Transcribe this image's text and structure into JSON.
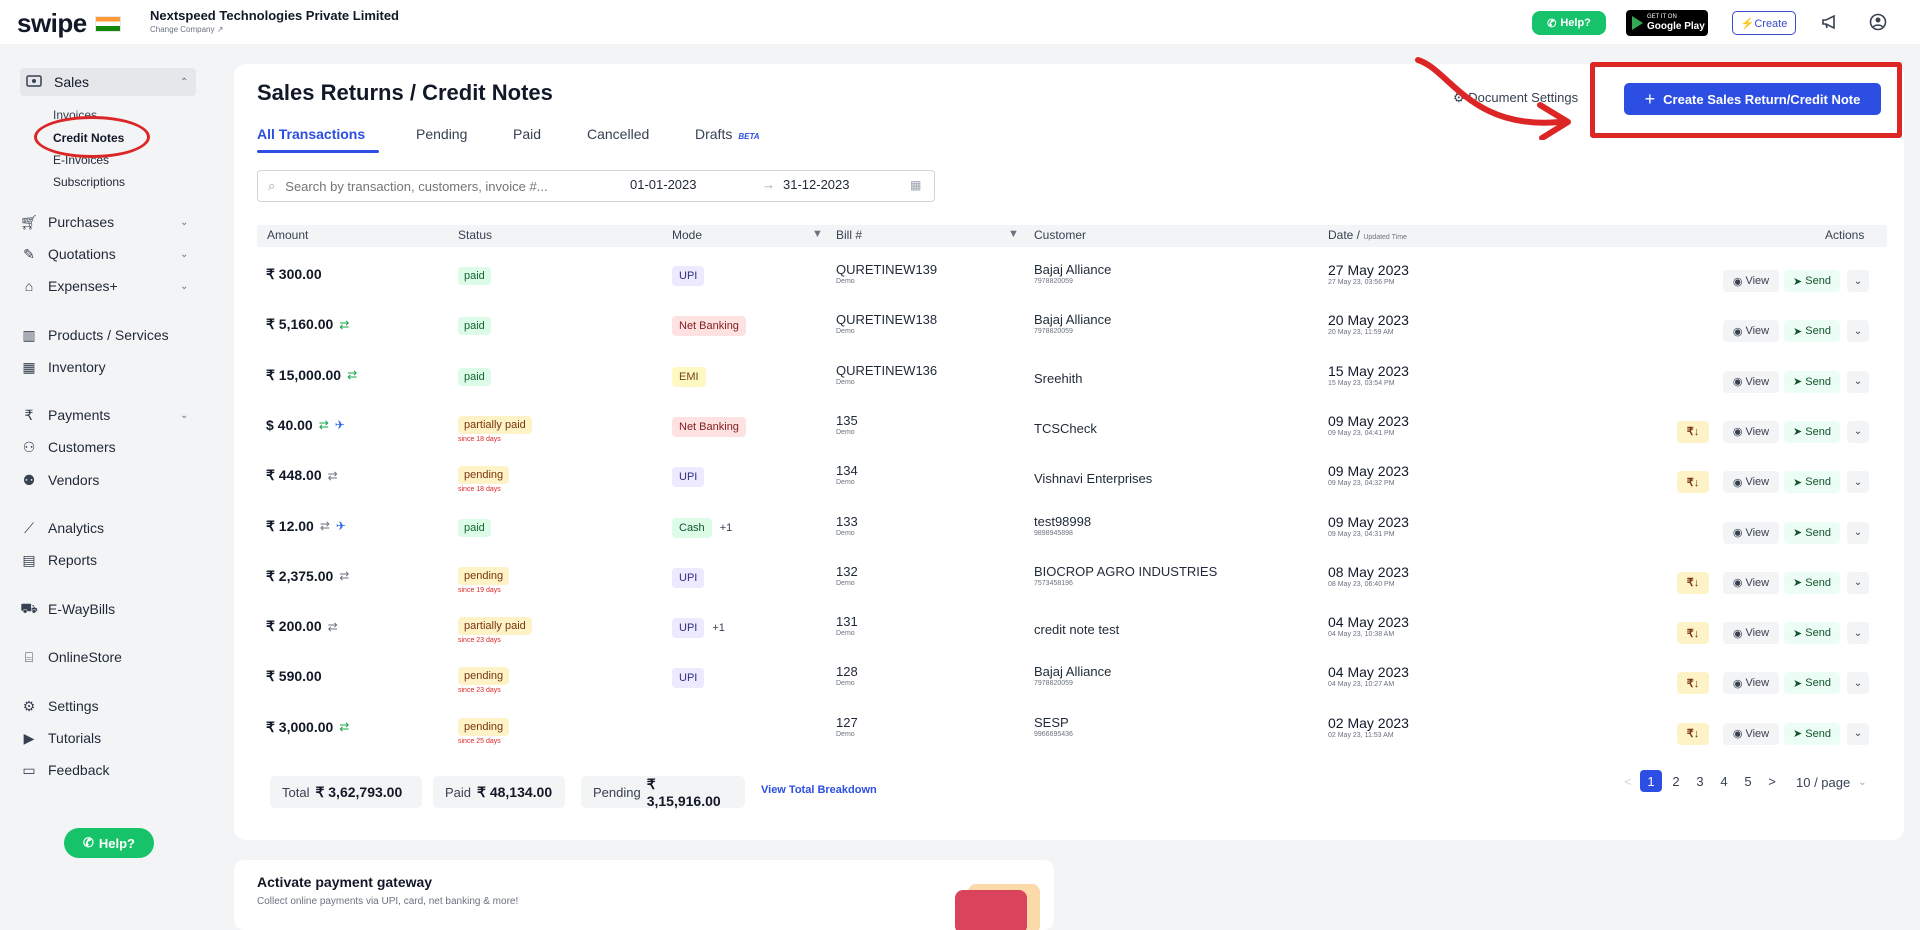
{
  "app": {
    "logo_text": "swipe",
    "company_name": "Nextspeed Technologies Private Limited",
    "change_company": "Change Company ↗"
  },
  "topbar": {
    "help_label": "Help?",
    "gplay_small": "GET IT ON",
    "gplay_big": "Google Play",
    "create_label": "⚡Create"
  },
  "sidebar": {
    "sales": "Sales",
    "sub_items": [
      "Invoices",
      "Credit Notes",
      "E-Invoices",
      "Subscriptions"
    ],
    "items": [
      {
        "label": "Purchases",
        "icon": "cart-icon"
      },
      {
        "label": "Quotations",
        "icon": "pencil-icon"
      },
      {
        "label": "Expenses+",
        "icon": "tag-icon"
      },
      {
        "label": "Products / Services",
        "icon": "barcode-icon"
      },
      {
        "label": "Inventory",
        "icon": "warehouse-icon"
      },
      {
        "label": "Payments",
        "icon": "rupee-icon"
      },
      {
        "label": "Customers",
        "icon": "user-icon"
      },
      {
        "label": "Vendors",
        "icon": "users-icon"
      },
      {
        "label": "Analytics",
        "icon": "chart-icon"
      },
      {
        "label": "Reports",
        "icon": "report-icon"
      },
      {
        "label": "E-WayBills",
        "icon": "truck-icon"
      },
      {
        "label": "OnlineStore",
        "icon": "store-icon"
      },
      {
        "label": "Settings",
        "icon": "gear-icon"
      },
      {
        "label": "Tutorials",
        "icon": "youtube-icon"
      },
      {
        "label": "Feedback",
        "icon": "message-icon"
      }
    ],
    "help_label": "Help?"
  },
  "page": {
    "title": "Sales Returns / Credit Notes",
    "doc_settings": "Document Settings",
    "cta_label": "Create Sales Return/Credit Note",
    "tabs": [
      "All Transactions",
      "Pending",
      "Paid",
      "Cancelled",
      "Drafts"
    ],
    "beta": "BETA",
    "search_placeholder": "Search by transaction, customers, invoice #...",
    "date_from": "01-01-2023",
    "date_sep": "→",
    "date_to": "31-12-2023"
  },
  "table": {
    "headers": {
      "amount": "Amount",
      "status": "Status",
      "mode": "Mode",
      "bill": "Bill #",
      "customer": "Customer",
      "date": "Date / ",
      "date_small": "Updated Time",
      "actions": "Actions"
    },
    "rows": [
      {
        "amount": "₹ 300.00",
        "status": "paid",
        "since": "",
        "mode": "UPI",
        "extra": "",
        "bill": "QURETINEW139",
        "bill_sub": "Demo",
        "customer": "Bajaj Alliance",
        "customer_sub": "7978820059",
        "date": "27 May 2023",
        "date_sub": "27 May 23, 03:56 PM"
      },
      {
        "amount": "₹ 5,160.00",
        "status": "paid",
        "since": "",
        "mode": "Net Banking",
        "extra": "",
        "bill": "QURETINEW138",
        "bill_sub": "Demo",
        "customer": "Bajaj Alliance",
        "customer_sub": "7978820059",
        "date": "20 May 2023",
        "date_sub": "20 May 23, 11:59 AM"
      },
      {
        "amount": "₹ 15,000.00",
        "status": "paid",
        "since": "",
        "mode": "EMI",
        "extra": "",
        "bill": "QURETINEW136",
        "bill_sub": "Demo",
        "customer": "Sreehith",
        "customer_sub": "",
        "date": "15 May 2023",
        "date_sub": "15 May 23, 03:54 PM"
      },
      {
        "amount": "$ 40.00",
        "status": "partially paid",
        "since": "since 18 days",
        "mode": "Net Banking",
        "extra": "",
        "bill": "135",
        "bill_sub": "Demo",
        "customer": "TCSCheck",
        "customer_sub": "",
        "date": "09 May 2023",
        "date_sub": "09 May 23, 04:41 PM"
      },
      {
        "amount": "₹ 448.00",
        "status": "pending",
        "since": "since 18 days",
        "mode": "UPI",
        "extra": "",
        "bill": "134",
        "bill_sub": "Demo",
        "customer": "Vishnavi Enterprises",
        "customer_sub": "",
        "date": "09 May 2023",
        "date_sub": "09 May 23, 04:32 PM"
      },
      {
        "amount": "₹ 12.00",
        "status": "paid",
        "since": "",
        "mode": "Cash",
        "extra": "+1",
        "bill": "133",
        "bill_sub": "Demo",
        "customer": "test98998",
        "customer_sub": "9898945898",
        "date": "09 May 2023",
        "date_sub": "09 May 23, 04:31 PM"
      },
      {
        "amount": "₹ 2,375.00",
        "status": "pending",
        "since": "since 19 days",
        "mode": "UPI",
        "extra": "",
        "bill": "132",
        "bill_sub": "Demo",
        "customer": "BIOCROP AGRO INDUSTRIES",
        "customer_sub": "7573458196",
        "date": "08 May 2023",
        "date_sub": "08 May 23, 06:40 PM"
      },
      {
        "amount": "₹ 200.00",
        "status": "partially paid",
        "since": "since 23 days",
        "mode": "UPI",
        "extra": "+1",
        "bill": "131",
        "bill_sub": "Demo",
        "customer": "credit note test",
        "customer_sub": "",
        "date": "04 May 2023",
        "date_sub": "04 May 23, 10:38 AM"
      },
      {
        "amount": "₹ 590.00",
        "status": "pending",
        "since": "since 23 days",
        "mode": "UPI",
        "extra": "",
        "bill": "128",
        "bill_sub": "Demo",
        "customer": "Bajaj Alliance",
        "customer_sub": "7978820059",
        "date": "04 May 2023",
        "date_sub": "04 May 23, 10:27 AM"
      },
      {
        "amount": "₹ 3,000.00",
        "status": "pending",
        "since": "since 25 days",
        "mode": "",
        "extra": "",
        "bill": "127",
        "bill_sub": "Demo",
        "customer": "SESP",
        "customer_sub": "9966695436",
        "date": "02 May 2023",
        "date_sub": "02 May 23, 11:53 AM"
      }
    ],
    "view_label": "View",
    "send_label": "Send",
    "rupee_label": "₹↓"
  },
  "totals": {
    "total_label": "Total",
    "total_value": "₹ 3,62,793.00",
    "paid_label": "Paid",
    "paid_value": "₹ 48,134.00",
    "pending_label": "Pending",
    "pending_value": "₹ 3,15,916.00",
    "breakdown": "View Total Breakdown"
  },
  "pagination": {
    "pages": [
      "1",
      "2",
      "3",
      "4",
      "5"
    ],
    "prev": "<",
    "next": ">",
    "per_page": "10 / page",
    "current_page": 1
  },
  "gateway": {
    "title": "Activate payment gateway",
    "subtitle": "Collect online payments via UPI, card, net banking & more!"
  },
  "colors": {
    "brand": "#2c4ee3",
    "highlight": "#dc2626",
    "whatsapp": "#16c26a"
  }
}
